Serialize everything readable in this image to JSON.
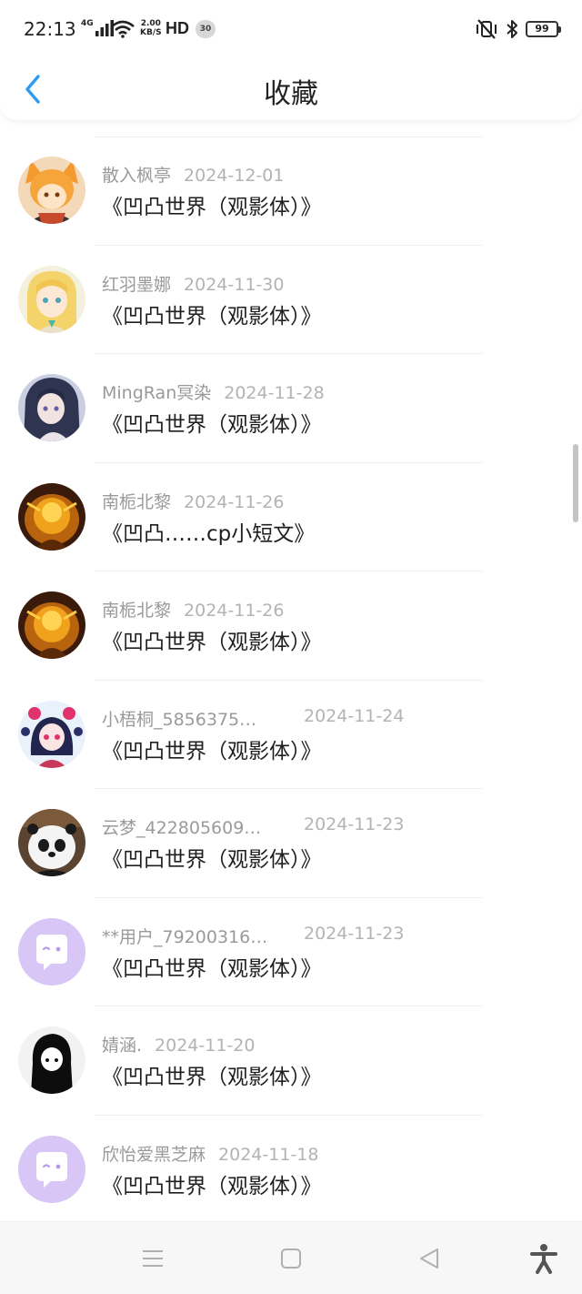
{
  "status_bar": {
    "time": "22:13",
    "network": "4G",
    "speed_value": "2.00",
    "speed_unit": "KB/S",
    "hd_label": "HD",
    "notification_count": "30",
    "battery": "99",
    "icons": [
      "signal-icon",
      "wifi-icon",
      "vibrate-off-icon",
      "bluetooth-icon",
      "battery-icon"
    ]
  },
  "header": {
    "title": "收藏",
    "back_icon": "chevron-left-icon",
    "accent_color": "#2e9bf0"
  },
  "favorites": [
    {
      "user": "散入枫亭",
      "date": "2024-12-01",
      "title": "《凹凸世界（观影体）》",
      "avatar": "anime-orange-fox"
    },
    {
      "user": "红羽墨娜",
      "date": "2024-11-30",
      "title": "《凹凸世界（观影体）》",
      "avatar": "anime-blonde-girl"
    },
    {
      "user": "MingRan冥染",
      "date": "2024-11-28",
      "title": "《凹凸世界（观影体）》",
      "avatar": "anime-dark-hair"
    },
    {
      "user": "南栀北黎",
      "date": "2024-11-26",
      "title": "《凹凸……cp小短文》",
      "avatar": "golden-glow"
    },
    {
      "user": "南栀北黎",
      "date": "2024-11-26",
      "title": "《凹凸世界（观影体）》",
      "avatar": "golden-glow"
    },
    {
      "user": "小梧桐_5856375…",
      "date": "2024-11-24",
      "title": "《凹凸世界（观影体）》",
      "avatar": "anime-colorful"
    },
    {
      "user": "云梦_422805609…",
      "date": "2024-11-23",
      "title": "《凹凸世界（观影体）》",
      "avatar": "panda-bear"
    },
    {
      "user": "**用户_79200316…",
      "date": "2024-11-23",
      "title": "《凹凸世界（观影体）》",
      "avatar": "default-purple"
    },
    {
      "user": "婧涵.",
      "date": "2024-11-20",
      "title": "《凹凸世界（观影体）》",
      "avatar": "black-silhouette"
    },
    {
      "user": "欣怡爱黑芝麻",
      "date": "2024-11-18",
      "title": "《凹凸世界（观影体）》",
      "avatar": "default-purple"
    }
  ],
  "system_nav": {
    "icons": [
      "menu-icon",
      "home-square-icon",
      "back-triangle-icon",
      "accessibility-icon"
    ]
  }
}
